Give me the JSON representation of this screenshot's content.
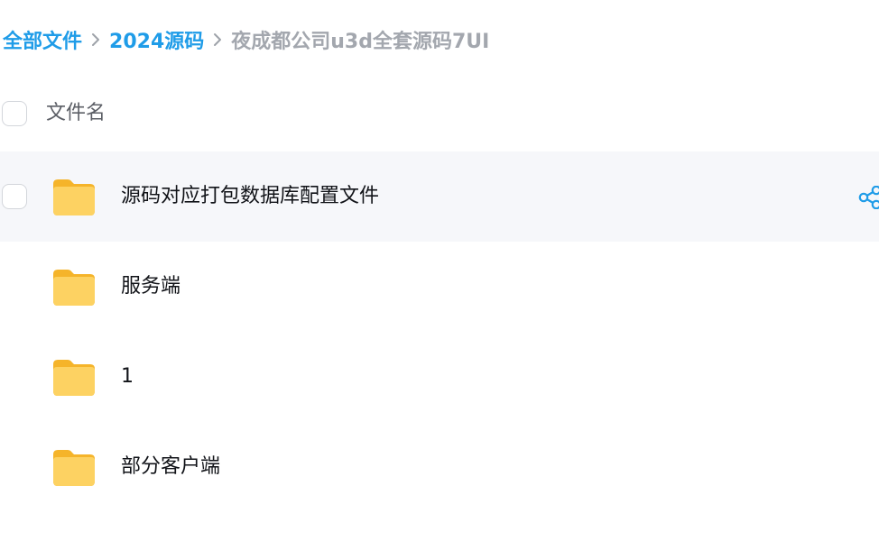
{
  "breadcrumb": {
    "items": [
      "全部文件",
      "2024源码"
    ],
    "current": "夜成都公司u3d全套源码7UI"
  },
  "list_header": {
    "name_label": "文件名"
  },
  "files": [
    {
      "name": "源码对应打包数据库配置文件",
      "icon": "folder-icon",
      "hovered": true
    },
    {
      "name": "服务端",
      "icon": "folder-icon"
    },
    {
      "name": "1",
      "icon": "folder-icon"
    },
    {
      "name": "部分客户端",
      "icon": "folder-icon"
    }
  ],
  "colors": {
    "link": "#1f9ce8",
    "breadcrumb_current": "#a3a7ae",
    "row_hover": "#f6f7fa",
    "folder": "#fcc43f",
    "share_icon": "#1f9ce8"
  }
}
